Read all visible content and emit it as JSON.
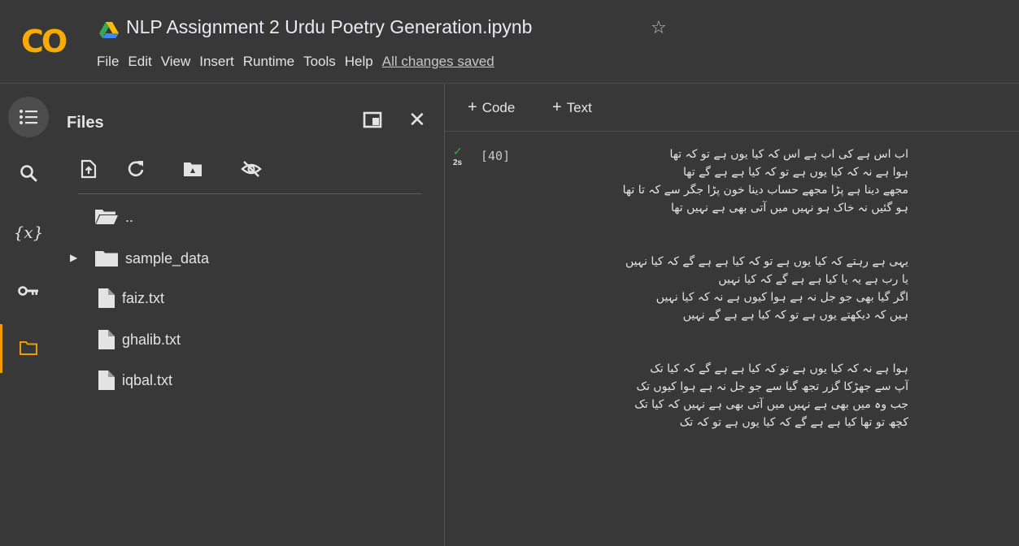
{
  "app": {
    "logo_text": "CO",
    "notebook_title": "NLP Assignment 2 Urdu Poetry Generation.ipynb",
    "star_icon": "star-outline-icon",
    "save_status": "All changes saved"
  },
  "menu": [
    "File",
    "Edit",
    "View",
    "Insert",
    "Runtime",
    "Tools",
    "Help"
  ],
  "sidebar_rail": {
    "items": [
      "table-of-contents-icon",
      "search-icon",
      "variables-icon",
      "key-icon",
      "folder-icon"
    ],
    "variables_glyph": "{x}",
    "active": "folder-icon",
    "accent_color": "#f29900"
  },
  "files_panel": {
    "title": "Files",
    "toolbar_icons": [
      "upload-file-icon",
      "refresh-icon",
      "mount-drive-icon",
      "hide-files-icon"
    ],
    "tree": [
      {
        "name": "..",
        "type": "folder-open"
      },
      {
        "name": "sample_data",
        "type": "folder",
        "collapsed": true
      },
      {
        "name": "faiz.txt",
        "type": "file"
      },
      {
        "name": "ghalib.txt",
        "type": "file"
      },
      {
        "name": "iqbal.txt",
        "type": "file"
      }
    ]
  },
  "notebook": {
    "add_code": "Code",
    "add_text": "Text",
    "cell": {
      "exec_count": "[40]",
      "exec_time": "2s",
      "status_color": "#34a853",
      "output": [
        [
          "اب اس ہے کی اب ہے اس کہ کیا یوں ہے تو کہ تھا",
          "ہوا ہے نہ کہ کیا یوں ہے تو کہ کیا ہے ہے گے تھا",
          "مجھے دینا ہے پڑا مجھے حساب دینا خون پڑا جگر سے کہ تا تھا",
          "ہو گئیں نہ خاک ہو نہیں میں آتی بھی ہے نہیں تھا"
        ],
        [
          "یہی ہے رہتے کہ کیا یوں ہے تو کہ کیا ہے ہے گے کہ کیا نہیں",
          "یا رب ہے یہ یا کیا ہے ہے گے کہ کیا نہیں",
          "اگر گیا بھی جو جل نہ ہے ہوا کیوں ہے نہ کہ کیا نہیں",
          "ہیں کہ دیکھتے یوں ہے تو کہ کیا ہے ہے گے نہیں"
        ],
        [
          "ہوا ہے نہ کہ کیا یوں ہے تو کہ کیا ہے ہے گے کہ کیا تک",
          "آپ سے جھڑکا گزر تجھ گیا سے جو جل نہ ہے ہوا کیوں تک",
          "جب وہ میں بھی ہے نہیں میں آتی بھی ہے نہیں کہ کیا تک",
          "کچھ تو تھا کیا ہے ہے گے کہ کیا یوں ہے تو کہ تک"
        ]
      ]
    }
  }
}
